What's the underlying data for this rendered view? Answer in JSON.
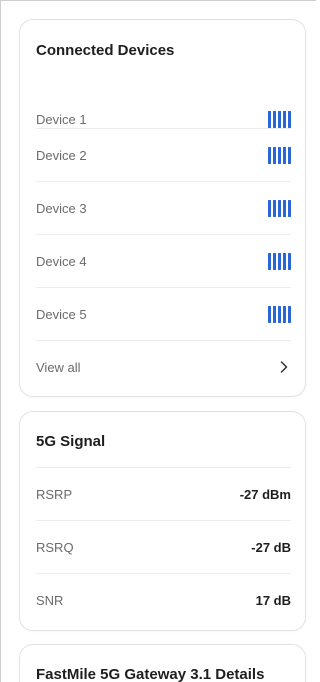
{
  "connected_devices": {
    "title": "Connected Devices",
    "devices": [
      {
        "label": "Device 1",
        "signal_bars": 5
      },
      {
        "label": "Device 2",
        "signal_bars": 5
      },
      {
        "label": "Device 3",
        "signal_bars": 5
      },
      {
        "label": "Device 4",
        "signal_bars": 5
      },
      {
        "label": "Device 5",
        "signal_bars": 5
      }
    ],
    "view_all_label": "View all",
    "signal_icon": "signal-strength-icon",
    "chevron_icon": "chevron-right-icon"
  },
  "signal_5g": {
    "title": "5G Signal",
    "metrics": [
      {
        "label": "RSRP",
        "value": "-27 dBm"
      },
      {
        "label": "RSRQ",
        "value": "-27 dB"
      },
      {
        "label": "SNR",
        "value": "17 dB"
      }
    ]
  },
  "gateway_details": {
    "title": "FastMile 5G Gateway 3.1 Details"
  },
  "colors": {
    "accent": "#2b66d9",
    "border": "#e2e2e2",
    "label": "#6b6b6b",
    "text": "#1e1e1e"
  }
}
